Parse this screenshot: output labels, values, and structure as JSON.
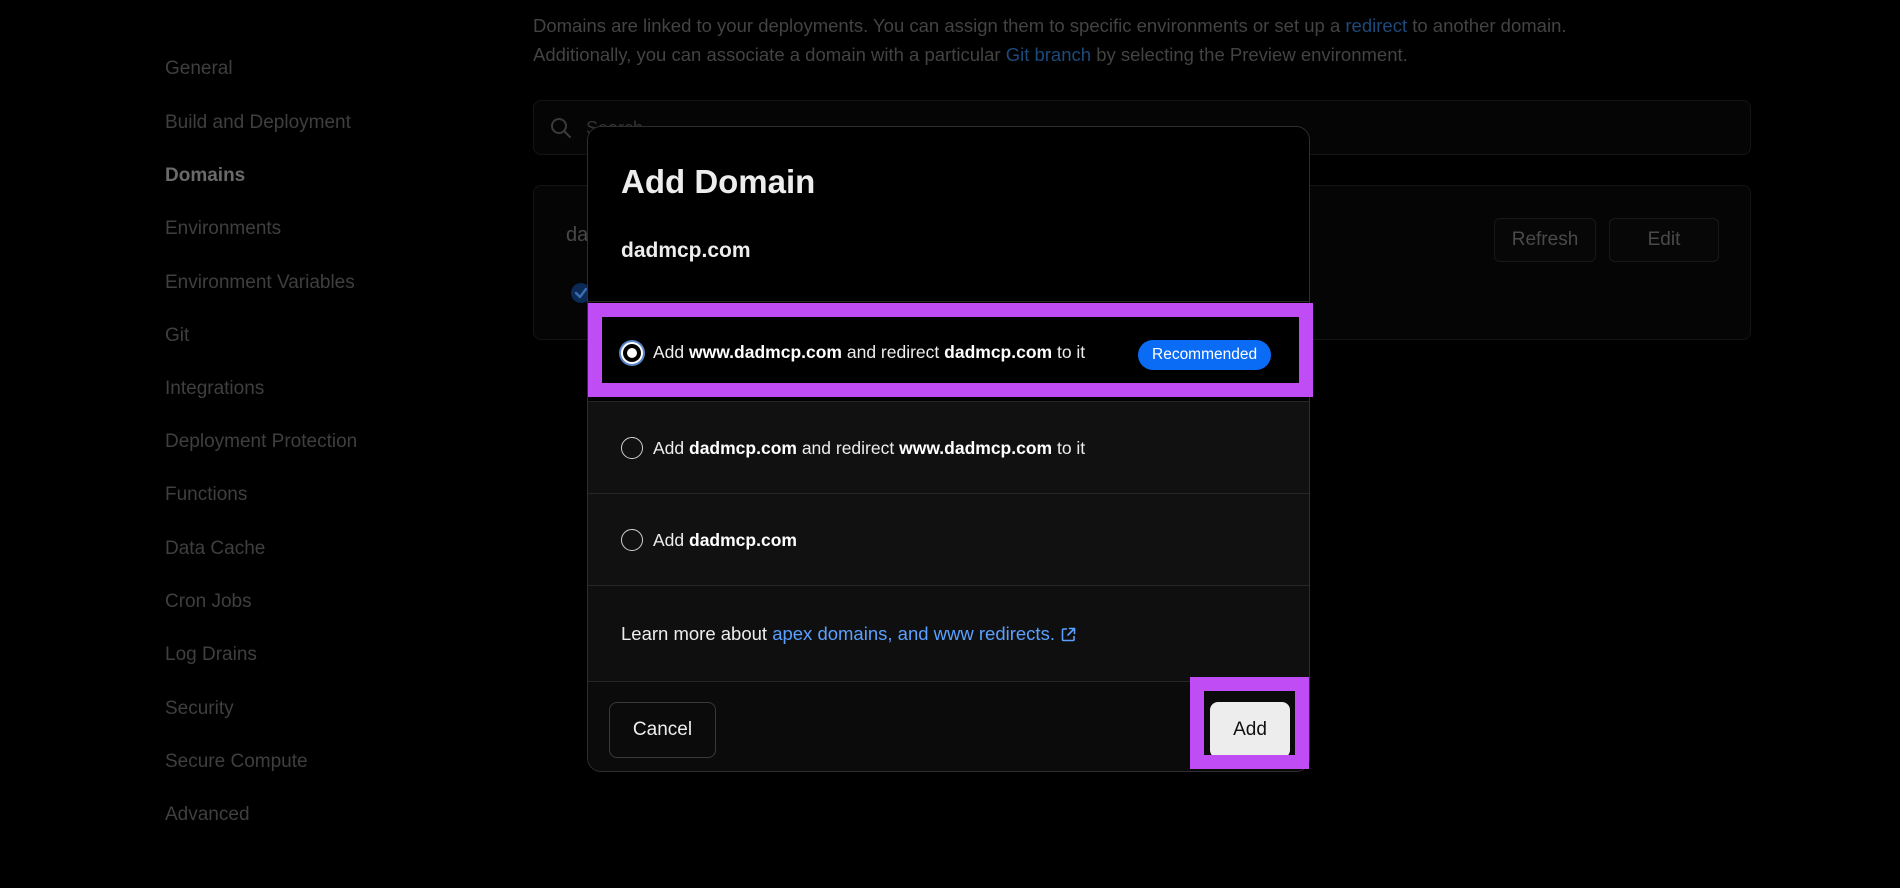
{
  "sidebar": {
    "items": [
      {
        "label": "General"
      },
      {
        "label": "Build and Deployment"
      },
      {
        "label": "Domains",
        "active": true
      },
      {
        "label": "Environments"
      },
      {
        "label": "Environment Variables"
      },
      {
        "label": "Git"
      },
      {
        "label": "Integrations"
      },
      {
        "label": "Deployment Protection"
      },
      {
        "label": "Functions"
      },
      {
        "label": "Data Cache"
      },
      {
        "label": "Cron Jobs"
      },
      {
        "label": "Log Drains"
      },
      {
        "label": "Security"
      },
      {
        "label": "Secure Compute"
      },
      {
        "label": "Advanced"
      }
    ]
  },
  "main": {
    "intro": {
      "line1_before": "Domains are linked to your deployments. You can assign them to specific environments or set up a ",
      "line1_link": "redirect",
      "line1_after": " to another domain.",
      "line2_before": "Additionally, you can associate a domain with a particular ",
      "line2_link": "Git branch",
      "line2_after": " by selecting the Preview environment."
    },
    "search": {
      "placeholder": "Search..."
    },
    "domain_card": {
      "name_visible": "da",
      "refresh_label": "Refresh",
      "edit_label": "Edit"
    }
  },
  "modal": {
    "title": "Add Domain",
    "domain": "dadmcp.com",
    "options": [
      {
        "selected": true,
        "parts": [
          "Add ",
          "www.dadmcp.com",
          " and redirect ",
          "dadmcp.com",
          " to it"
        ],
        "badge": "Recommended"
      },
      {
        "selected": false,
        "parts": [
          "Add ",
          "dadmcp.com",
          " and redirect ",
          "www.dadmcp.com",
          " to it"
        ]
      },
      {
        "selected": false,
        "parts": [
          "Add ",
          "dadmcp.com"
        ]
      }
    ],
    "learn_more": {
      "prefix": "Learn more about ",
      "link": "apex domains, and www redirects."
    },
    "cancel_label": "Cancel",
    "add_label": "Add"
  },
  "colors": {
    "highlight": "#c04cf5",
    "badge": "#0a6cf5",
    "link": "#5aa0ff",
    "modal_bg": "#0f0f0f",
    "page_bg": "#000000"
  }
}
